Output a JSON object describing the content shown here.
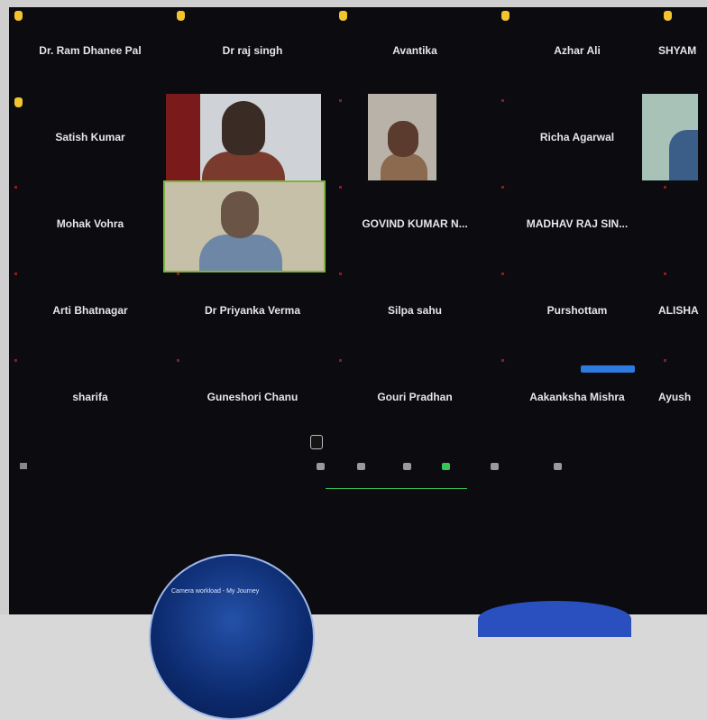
{
  "participants": [
    {
      "name": "Dr. Ram Dhanee Pal",
      "hand": true
    },
    {
      "name": "Dr raj singh",
      "hand": true
    },
    {
      "name": "Avantika",
      "hand": true
    },
    {
      "name": "Azhar Ali",
      "hand": true
    },
    {
      "name": "SHYAM",
      "hand": true
    },
    {
      "name": "Satish Kumar",
      "hand": true
    },
    {
      "name": "",
      "hand": false
    },
    {
      "name": "",
      "hand": false
    },
    {
      "name": "Richa Agarwal",
      "hand": false
    },
    {
      "name": "",
      "hand": false
    },
    {
      "name": "Mohak Vohra",
      "hand": false
    },
    {
      "name": "",
      "hand": false
    },
    {
      "name": "GOVIND KUMAR N...",
      "hand": false
    },
    {
      "name": "MADHAV RAJ SIN...",
      "hand": false
    },
    {
      "name": "",
      "hand": false
    },
    {
      "name": "Arti Bhatnagar",
      "hand": false
    },
    {
      "name": "Dr Priyanka Verma",
      "hand": false
    },
    {
      "name": "Silpa sahu",
      "hand": false
    },
    {
      "name": "Purshottam",
      "hand": false
    },
    {
      "name": "ALISHA",
      "hand": false
    },
    {
      "name": "sharifa",
      "hand": false
    },
    {
      "name": "Guneshori Chanu",
      "hand": false
    },
    {
      "name": "Gouri Pradhan",
      "hand": false
    },
    {
      "name": "Aakanksha Mishra",
      "hand": false
    },
    {
      "name": "Ayush",
      "hand": false
    }
  ],
  "globe_caption": "Camera workload - My Journey"
}
